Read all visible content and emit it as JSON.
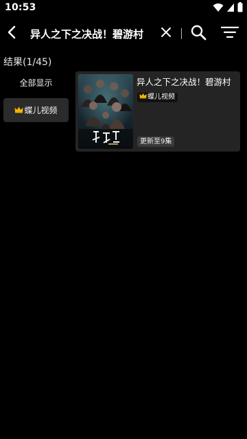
{
  "status_bar": {
    "time": "10:53"
  },
  "toolbar": {
    "query": "异人之下之决战！碧游村"
  },
  "results": {
    "count_label": "结果(1/45)"
  },
  "sources": [
    {
      "label": "全部显示",
      "selected": false
    },
    {
      "label": "蝶儿视频",
      "selected": true,
      "icon": "crown-icon"
    }
  ],
  "items": [
    {
      "title": "异人之下之决战！碧游村",
      "source": "蝶儿视频",
      "source_icon": "crown-icon",
      "update": "更新至9集"
    }
  ],
  "colors": {
    "background": "#000000",
    "card": "#242424",
    "selected_source": "#2b2b2b",
    "crown": "#f5b800"
  }
}
